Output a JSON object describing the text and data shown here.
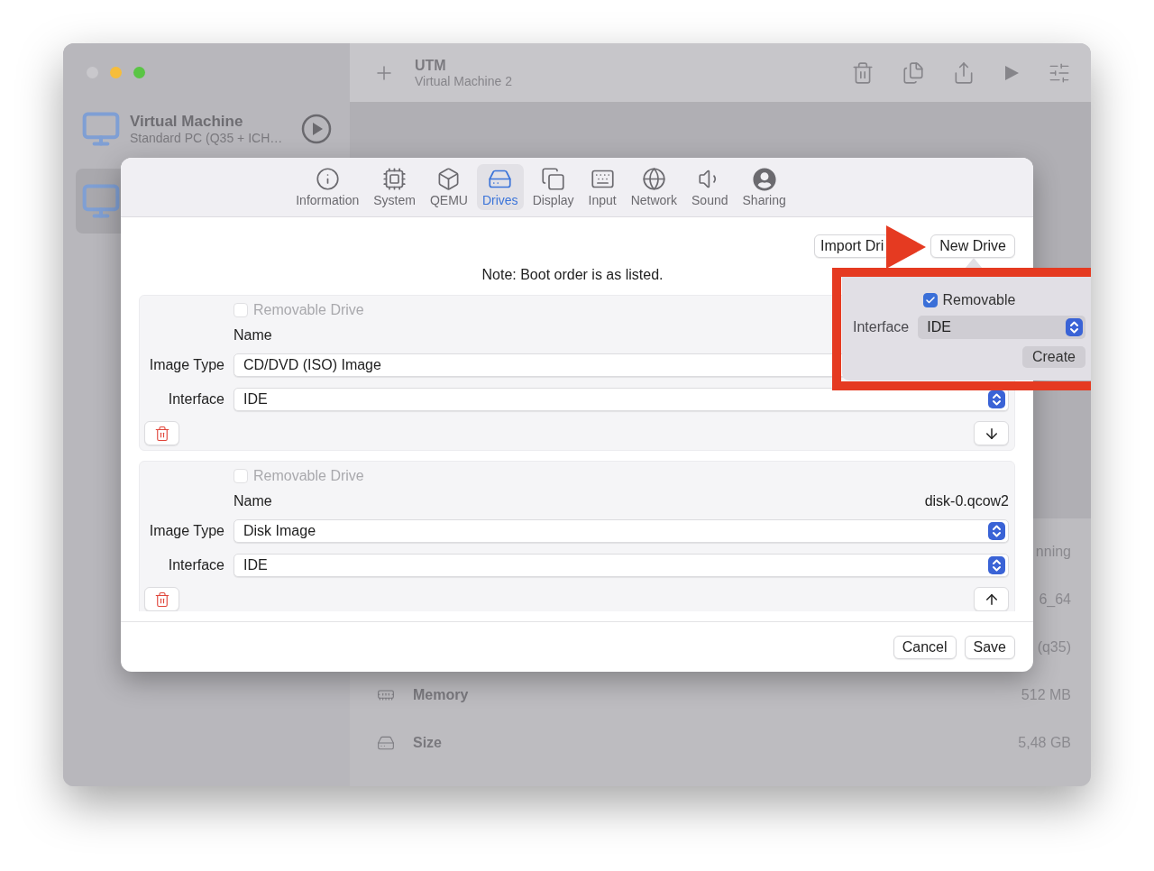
{
  "sidebar": {
    "items": [
      {
        "title": "Virtual Machine",
        "subtitle": "Standard PC (Q35 + ICH…",
        "selected": false
      },
      {
        "selected": true
      }
    ]
  },
  "toolbar": {
    "title": "UTM",
    "subtitle": "Virtual Machine 2"
  },
  "details": [
    {
      "value": "nning"
    },
    {
      "value": "6_64"
    },
    {
      "value": "(q35)"
    },
    {
      "kind": "memory",
      "label": "Memory",
      "value": "512 MB"
    },
    {
      "kind": "disk",
      "label": "Size",
      "value": "5,48 GB"
    }
  ],
  "dialog": {
    "tabs": [
      {
        "kind": "info",
        "label": "Information",
        "selected": false
      },
      {
        "kind": "cpu",
        "label": "System",
        "selected": false
      },
      {
        "kind": "box",
        "label": "QEMU",
        "selected": false
      },
      {
        "kind": "drive",
        "label": "Drives",
        "selected": true
      },
      {
        "kind": "display",
        "label": "Display",
        "selected": false
      },
      {
        "kind": "keyboard",
        "label": "Input",
        "selected": false
      },
      {
        "kind": "globe",
        "label": "Network",
        "selected": false
      },
      {
        "kind": "sound",
        "label": "Sound",
        "selected": false
      },
      {
        "kind": "user",
        "label": "Sharing",
        "selected": false
      }
    ],
    "import_button": "Import Dri",
    "new_button": "New Drive",
    "note": "Note: Boot order is as listed.",
    "drives": [
      {
        "removable_label": "Removable Drive",
        "removable": false,
        "disabled": true,
        "name_label": "Name",
        "image_type_label": "Image Type",
        "image_type": "CD/DVD (ISO) Image",
        "interface_label": "Interface",
        "interface": "IDE",
        "kind": "down"
      },
      {
        "removable_label": "Removable Drive",
        "removable": false,
        "disabled": true,
        "name_label": "Name",
        "name": "disk-0.qcow2",
        "image_type_label": "Image Type",
        "image_type": "Disk Image",
        "interface_label": "Interface",
        "interface": "IDE",
        "kind": "up"
      }
    ],
    "footer_buttons": [
      "Cancel",
      "Save"
    ]
  },
  "popover": {
    "removable_label": "Removable",
    "removable": true,
    "interface_label": "Interface",
    "interface": "IDE",
    "create_button": "Create"
  }
}
